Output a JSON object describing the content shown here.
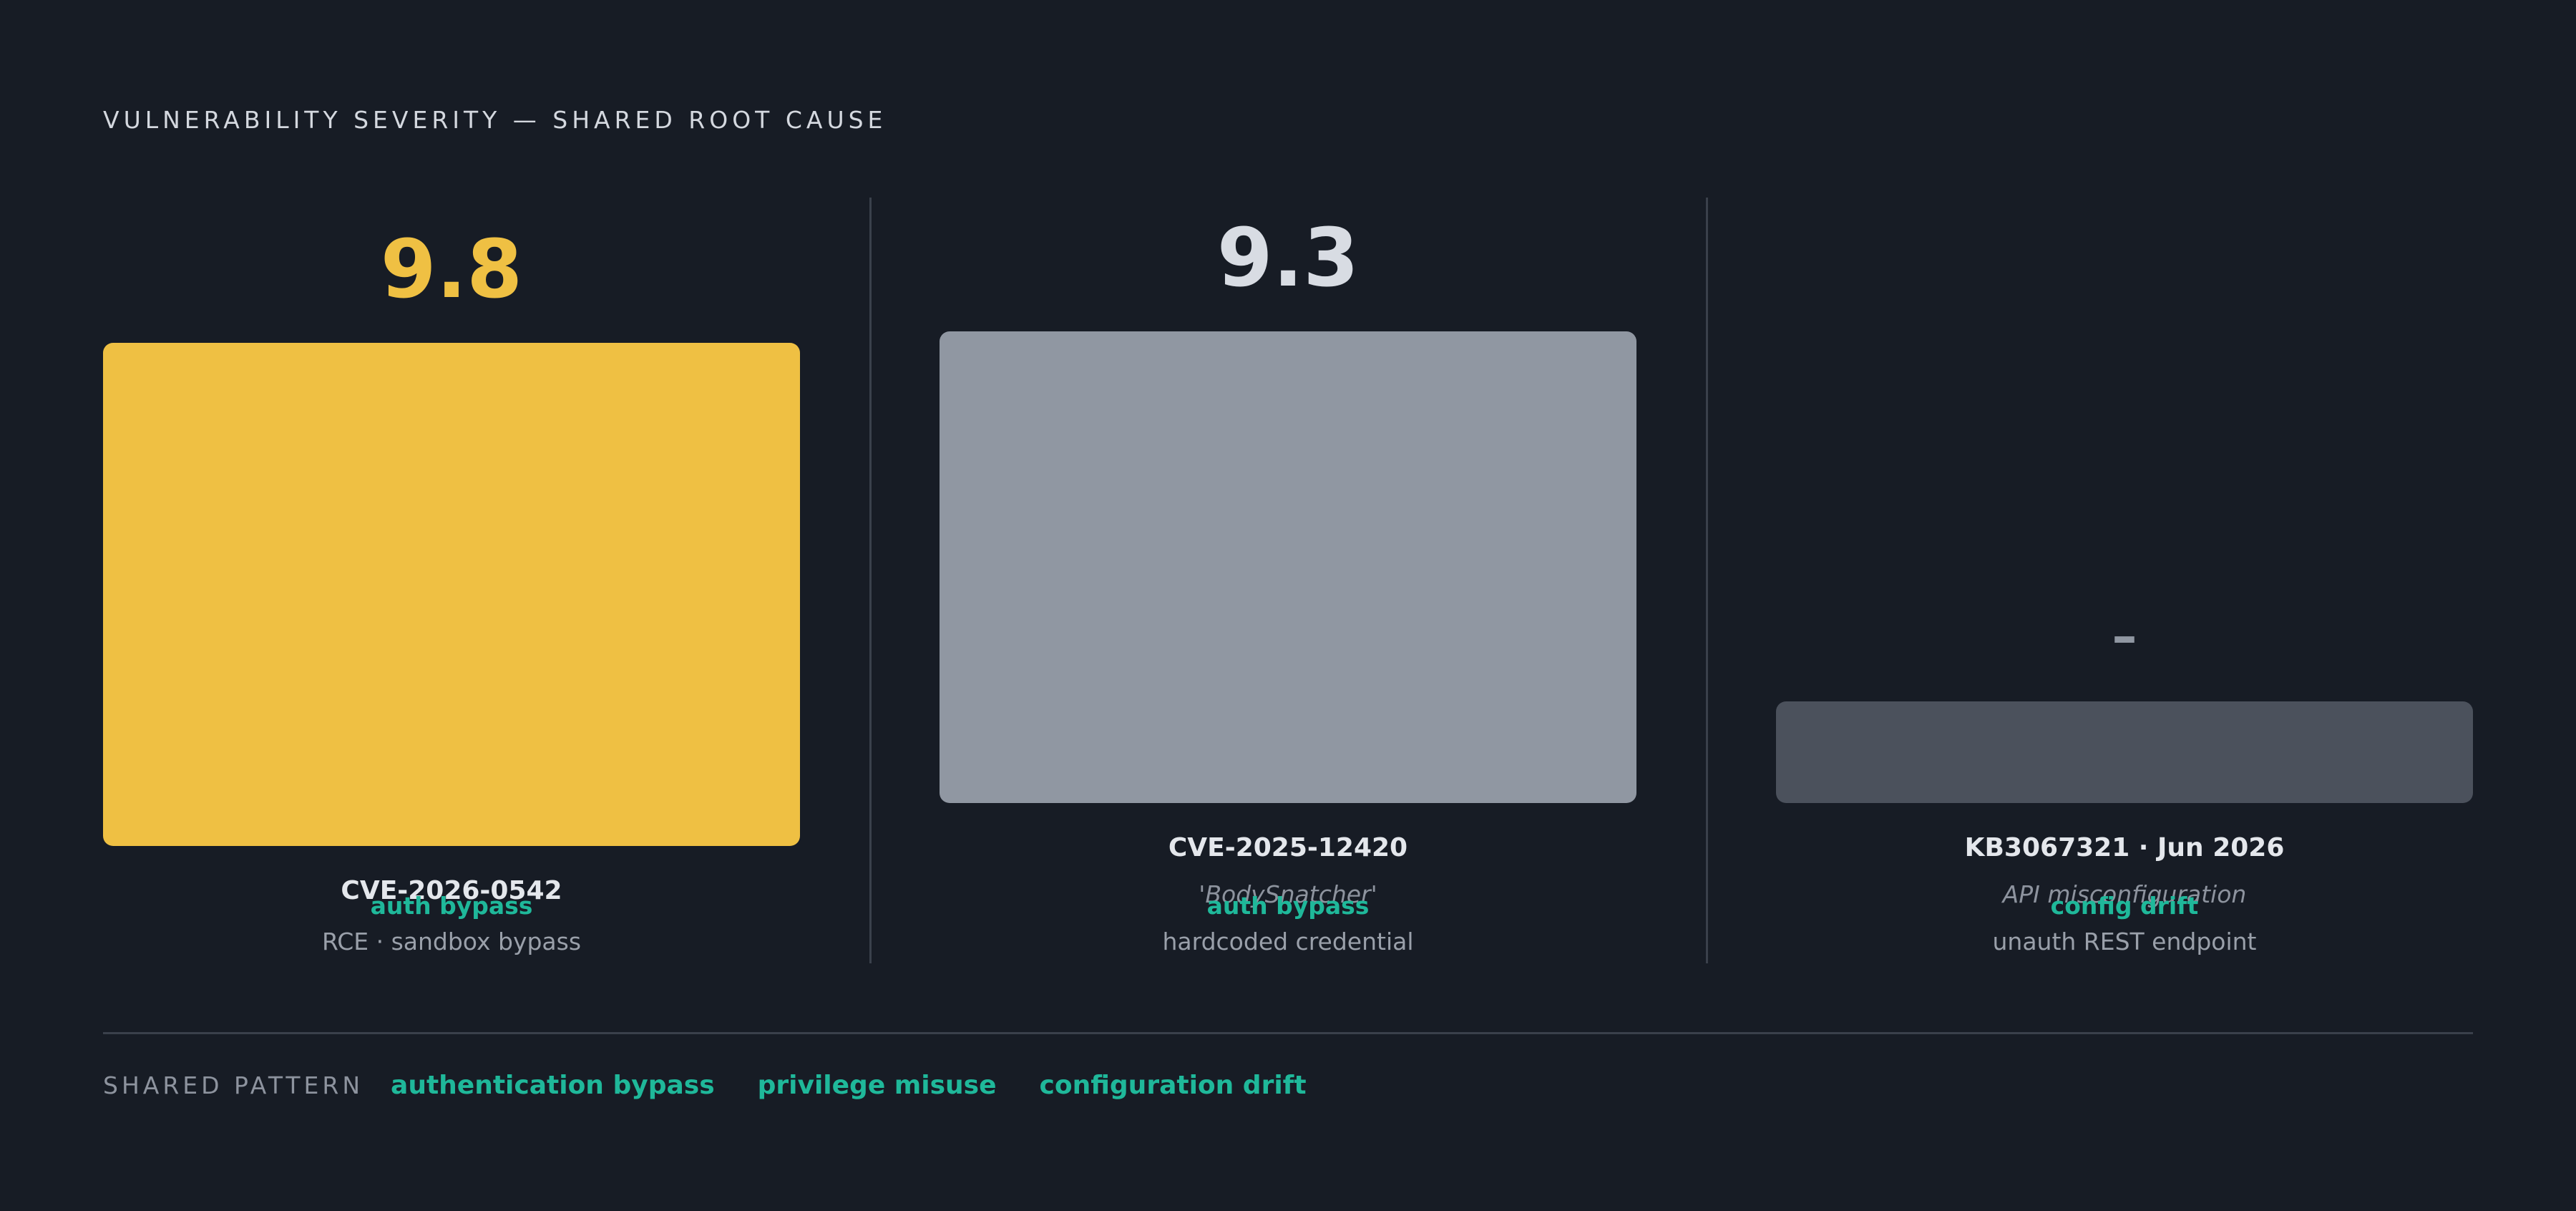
{
  "title": "VULNERABILITY SEVERITY — SHARED ROOT CAUSE",
  "chart_data": {
    "type": "bar",
    "title": "VULNERABILITY SEVERITY — SHARED ROOT CAUSE",
    "categories": [
      "CVE-2026-0542",
      "CVE-2025-12420",
      "KB3067321 · Jun 2026"
    ],
    "values": [
      9.8,
      9.3,
      null
    ],
    "ylim": [
      0,
      10
    ],
    "grid": false,
    "items": [
      {
        "id": "CVE-2026-0542",
        "score": 9.8,
        "score_label": "9.8",
        "nickname": "",
        "tag": "auth bypass",
        "detail": "RCE · sandbox bypass",
        "bar_color": "#efc043",
        "score_color": "#efc043"
      },
      {
        "id": "CVE-2025-12420",
        "score": 9.3,
        "score_label": "9.3",
        "nickname": "'BodySnatcher'",
        "tag": "auth bypass",
        "detail": "hardcoded credential",
        "bar_color": "#9097a2",
        "score_color": "#d8dce3"
      },
      {
        "id": "KB3067321 · Jun 2026",
        "score": null,
        "score_label": "–",
        "nickname": "API misconfiguration",
        "tag": "config drift",
        "detail": "unauth REST endpoint",
        "bar_color": "#4b515c",
        "score_color": "#9097a2"
      }
    ]
  },
  "footer": {
    "label": "SHARED PATTERN",
    "items": [
      "authentication bypass",
      "privilege misuse",
      "configuration drift"
    ]
  },
  "colors": {
    "background": "#171c25",
    "accent_teal": "#1fb89a",
    "highlight_yellow": "#efc043"
  }
}
